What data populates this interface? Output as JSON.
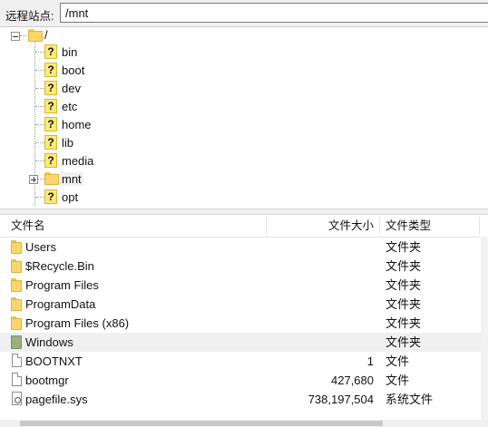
{
  "remote_site": {
    "label": "远程站点:",
    "path": "/mnt"
  },
  "tree": {
    "root": "/",
    "items": [
      {
        "name": "bin",
        "icon": "unknown-folder-icon"
      },
      {
        "name": "boot",
        "icon": "unknown-folder-icon"
      },
      {
        "name": "dev",
        "icon": "unknown-folder-icon"
      },
      {
        "name": "etc",
        "icon": "unknown-folder-icon"
      },
      {
        "name": "home",
        "icon": "unknown-folder-icon"
      },
      {
        "name": "lib",
        "icon": "unknown-folder-icon"
      },
      {
        "name": "media",
        "icon": "unknown-folder-icon"
      },
      {
        "name": "mnt",
        "icon": "folder-icon",
        "selected": true
      },
      {
        "name": "opt",
        "icon": "unknown-folder-icon"
      }
    ]
  },
  "file_list": {
    "columns": [
      "文件名",
      "文件大小",
      "文件类型"
    ],
    "rows": [
      {
        "name": "Users",
        "size": "",
        "type": "文件夹",
        "icon": "folder-icon"
      },
      {
        "name": "$Recycle.Bin",
        "size": "",
        "type": "文件夹",
        "icon": "folder-icon"
      },
      {
        "name": "Program Files",
        "size": "",
        "type": "文件夹",
        "icon": "folder-icon"
      },
      {
        "name": "ProgramData",
        "size": "",
        "type": "文件夹",
        "icon": "folder-icon"
      },
      {
        "name": "Program Files (x86)",
        "size": "",
        "type": "文件夹",
        "icon": "folder-icon"
      },
      {
        "name": "Windows",
        "size": "",
        "type": "文件夹",
        "icon": "system-folder-icon"
      },
      {
        "name": "BOOTNXT",
        "size": "1",
        "type": "文件",
        "icon": "file-icon"
      },
      {
        "name": "bootmgr",
        "size": "427,680",
        "type": "文件",
        "icon": "file-icon"
      },
      {
        "name": "pagefile.sys",
        "size": "738,197,504",
        "type": "系统文件",
        "icon": "system-file-icon"
      }
    ]
  }
}
